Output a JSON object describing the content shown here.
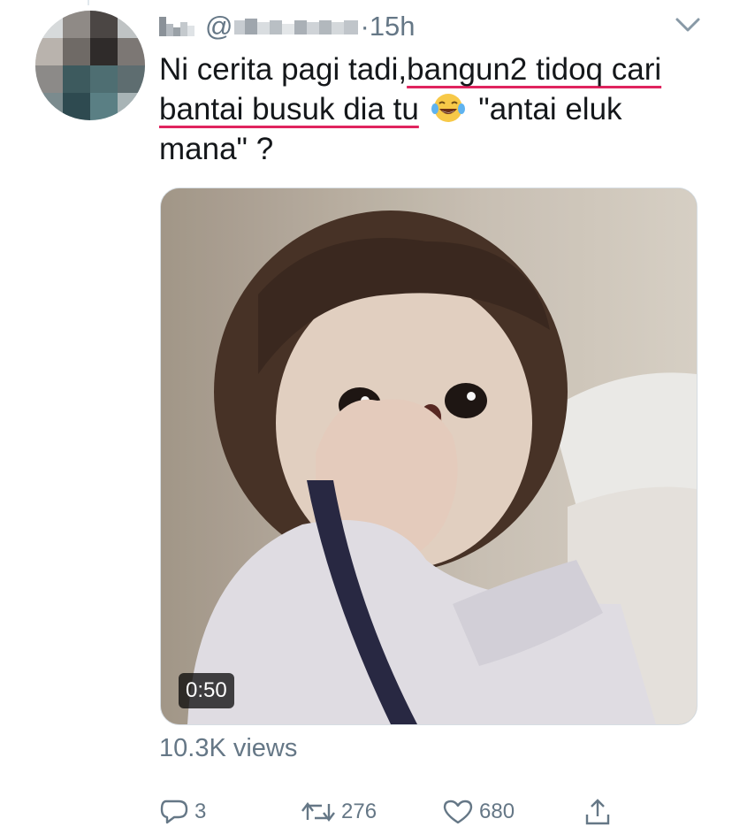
{
  "tweet": {
    "at_symbol": "@",
    "time_separator": "·",
    "time": "15h",
    "text_plain_1": "Ni cerita pagi tadi,",
    "text_highlight": "bangun2 tidoq cari bantai busuk dia tu",
    "text_plain_2": "\"antai eluk mana\" ?",
    "emoji": "tears-of-joy-emoji"
  },
  "video": {
    "duration": "0:50"
  },
  "stats": {
    "views": "10.3K views"
  },
  "actions": {
    "replies": "3",
    "retweets": "276",
    "likes": "680"
  },
  "colors": {
    "text": "#14171a",
    "secondary": "#657786",
    "highlight_underline": "#e0245e"
  }
}
